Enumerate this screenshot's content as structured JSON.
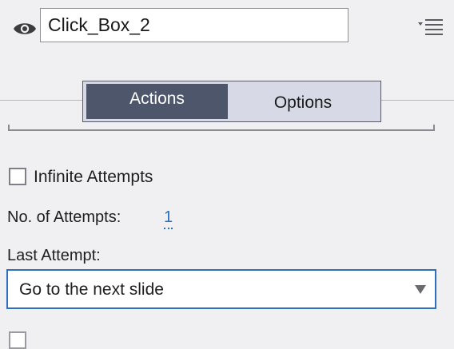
{
  "header": {
    "name_value": "Click_Box_2",
    "visibility_icon": "eye-icon",
    "menu_icon": "panel-menu-icon"
  },
  "tabs": [
    {
      "label": "Actions",
      "active": true
    },
    {
      "label": "Options",
      "active": false
    }
  ],
  "actions": {
    "infinite_attempts_label": "Infinite Attempts",
    "infinite_attempts_checked": false,
    "attempts_label": "No. of Attempts:",
    "attempts_value": "1",
    "last_attempt_label": "Last Attempt:",
    "last_attempt_selected": "Go to the next slide"
  },
  "colors": {
    "active_tab": "#4e566c",
    "inactive_tab": "#d7dae6",
    "focus_border": "#2f6fc0",
    "link_value": "#2c6fb4"
  }
}
